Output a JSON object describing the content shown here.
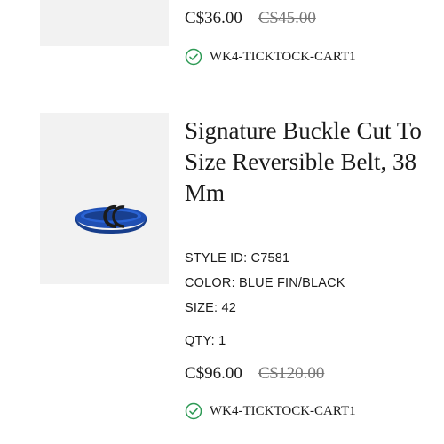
{
  "items": [
    {
      "price": "C$36.00",
      "original_price": "C$45.00",
      "promo_code": "WK4-TICKTOCK-CART1"
    },
    {
      "name": "Signature Buckle Cut To Size Reversible Belt, 38 Mm",
      "style_label": "STYLE ID:",
      "style_id": "C7581",
      "color_label": "COLOR:",
      "color": "BLUE FIN/BLACK",
      "size_label": "SIZE:",
      "size": "42",
      "qty_label": "QTY:",
      "qty": "1",
      "price": "C$96.00",
      "original_price": "C$120.00",
      "promo_code": "WK4-TICKTOCK-CART1"
    }
  ],
  "icons": {
    "promo": "check-circle-icon",
    "check_color": "#2e9a55",
    "belt_color": "#1f4fb3"
  }
}
